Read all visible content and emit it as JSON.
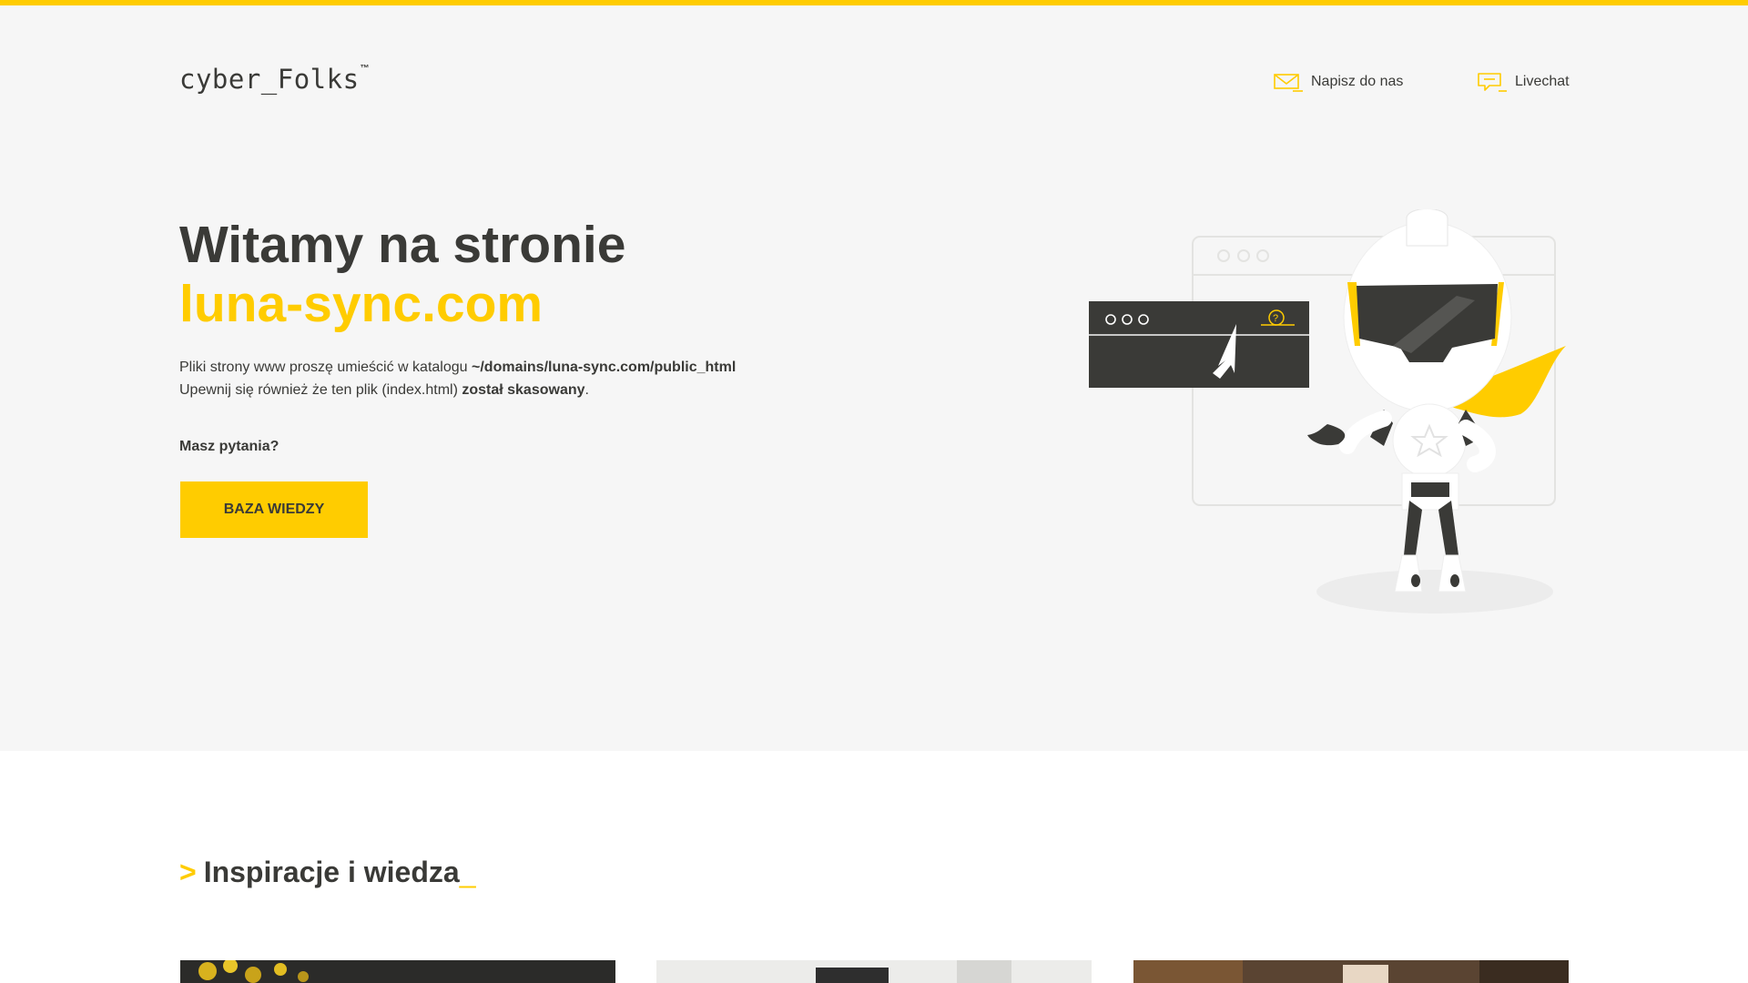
{
  "brand": {
    "name": "cyber_Folks",
    "trademark": "™",
    "accent": "#ffcc00",
    "dark": "#3a3a37",
    "background": "#f6f6f6"
  },
  "nav": {
    "mail": {
      "label": "Napisz do nas",
      "icon": "envelope-icon"
    },
    "chat": {
      "label": "Livechat",
      "icon": "chat-bubble-icon"
    }
  },
  "hero": {
    "title_line1": "Witamy na stronie",
    "domain": "luna-sync.com",
    "info_line1_prefix": "Pliki strony www proszę umieścić w katalogu ",
    "info_line1_path": "~/domains/luna-sync.com/public_html",
    "info_line2_prefix": "Upewnij się również że ten plik (index.html) ",
    "info_line2_bold": "został skasowany",
    "info_line2_suffix": ".",
    "question": "Masz pytania?",
    "button_label": "BAZA WIEDZY"
  },
  "illustration": {
    "icon": "robot-mascot-icon",
    "browser_icon": "browser-window-icon",
    "cursor_icon": "mouse-cursor-icon",
    "help_icon": "help-question-icon"
  },
  "section": {
    "prompt": ">",
    "title": "Inspiracje i wiedza",
    "cursor": "_"
  },
  "cards": [
    {
      "image": "yellow-flowers-photo"
    },
    {
      "image": "laptop-desk-photo"
    },
    {
      "image": "warm-interior-photo"
    }
  ]
}
